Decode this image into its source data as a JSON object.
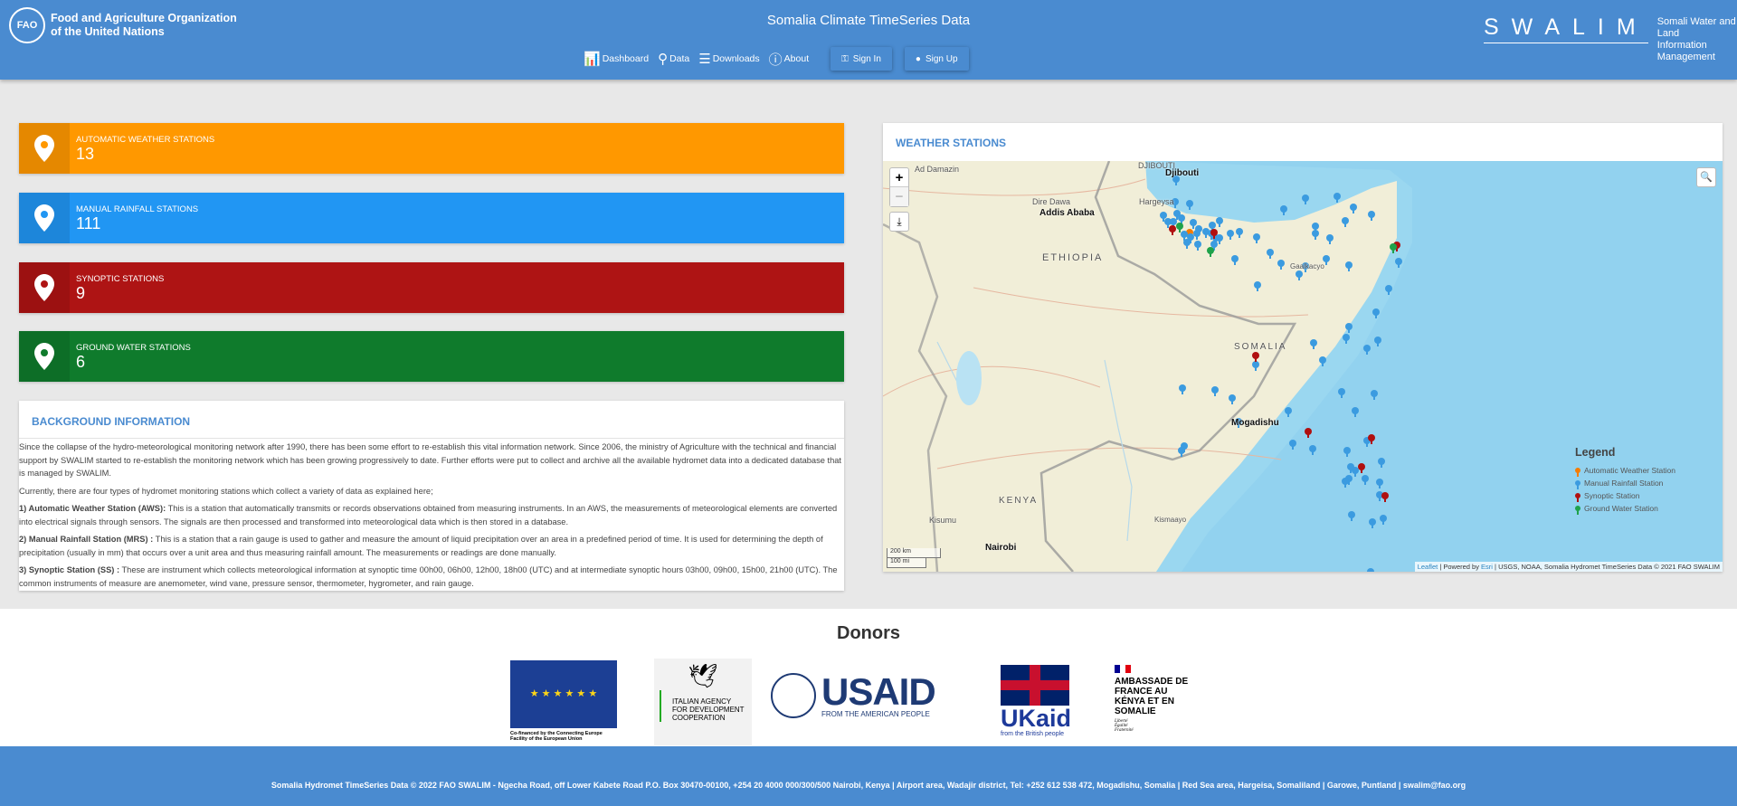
{
  "header": {
    "org_name_line1": "Food and Agriculture Organization",
    "org_name_line2": "of the United Nations",
    "title": "Somalia Climate TimeSeries Data",
    "nav": [
      {
        "label": "Dashboard",
        "icon": "bar-chart-icon"
      },
      {
        "label": "Data",
        "icon": "map-marker-icon"
      },
      {
        "label": "Downloads",
        "icon": "database-icon"
      },
      {
        "label": "About",
        "icon": "info-icon"
      }
    ],
    "sign_in": "Sign In",
    "sign_up": "Sign Up",
    "swalim_logo": "SWALIM",
    "swalim_line1": "Somali Water and Land",
    "swalim_line2": "Information Management"
  },
  "stations": [
    {
      "label": "AUTOMATIC WEATHER STATIONS",
      "count": "13",
      "color": "#ff9800"
    },
    {
      "label": "MANUAL RAINFALL STATIONS",
      "count": "111",
      "color": "#2196f3"
    },
    {
      "label": "SYNOPTIC STATIONS",
      "count": "9",
      "color": "#ae1414"
    },
    {
      "label": "GROUND WATER STATIONS",
      "count": "6",
      "color": "#0f7b2c"
    }
  ],
  "background": {
    "title": "BACKGROUND INFORMATION",
    "p1": "Since the collapse of the hydro-meteorological monitoring network after 1990, there has been some effort to re-establish this vital information network. Since 2006, the ministry of Agriculture with the technical and financial support by SWALIM started to re-establish the monitoring network which has been growing progressively to date. Further efforts were put to collect and archive all the available hydromet data into a dedicated database that is managed by SWALIM.",
    "p2": "Currently, there are four types of hydromet monitoring stations which collect a variety of data as explained here;",
    "aws_head": "1) Automatic Weather Station (AWS):",
    "aws_text": " This is a station that automatically transmits or records observations obtained from measuring instruments. In an AWS, the measurements of meteorological elements are converted into electrical signals through sensors. The signals are then processed and transformed into meteorological data which is then stored in a database.",
    "mrs_head": "2) Manual Rainfall Station (MRS) :",
    "mrs_text": " This is a station that a rain gauge is used to gather and measure the amount of liquid precipitation over an area in a predefined period of time. It is used for determining the depth of precipitation (usually in mm) that occurs over a unit area and thus measuring rainfall amount. The measurements or readings are done manually.",
    "ss_head": "3) Synoptic Station (SS) :",
    "ss_text": " These are instrument which collects meteorological information at synoptic time 00h00, 06h00, 12h00, 18h00 (UTC) and at intermediate synoptic hours 03h00, 09h00, 15h00, 21h00 (UTC). The common instruments of measure are anemometer, wind vane, pressure sensor, thermometer, hygrometer, and rain gauge."
  },
  "map": {
    "title": "WEATHER STATIONS",
    "zoom_in": "+",
    "zoom_out": "−",
    "places": {
      "ad_damazin": "Ad Damazin",
      "djibouti_country": "DJIBOUTI",
      "djibouti": "Djibouti",
      "dire_dawa": "Dire Dawa",
      "hargeysa": "Hargeysa",
      "addis": "Addis Ababa",
      "ethiopia": "ETHIOPIA",
      "gaalkacyo": "Gaalkacyo",
      "somalia": "SOMALIA",
      "mogadishu": "Mogadishu",
      "kenya": "KENYA",
      "kisumu": "Kisumu",
      "nairobi": "Nairobi",
      "kismaayo": "Kismaayo"
    },
    "legend": {
      "title": "Legend",
      "items": [
        {
          "label": "Automatic Weather Station",
          "color": "#f57c00"
        },
        {
          "label": "Manual Rainfall Station",
          "color": "#3b9be0"
        },
        {
          "label": "Synoptic Station",
          "color": "#b01010"
        },
        {
          "label": "Ground Water Station",
          "color": "#1fa24a"
        }
      ]
    },
    "scale_km": "200 km",
    "scale_mi": "100 mi",
    "attrib_leaflet": "Leaflet",
    "attrib_sep1": " | Powered by ",
    "attrib_esri": "Esri",
    "attrib_rest": " | USGS, NOAA, Somalia Hydromet TimeSeries Data © 2021 FAO SWALIM"
  },
  "donors": {
    "title": "Donors",
    "eu_caption": "Co-financed by the Connecting Europe Facility of the European Union",
    "italian": "ITALIAN AGENCY FOR DEVELOPMENT COOPERATION",
    "usaid": "USAID",
    "usaid_sub": "FROM THE AMERICAN PEOPLE",
    "ukaid": "UKaid",
    "ukaid_sub": "from the British people",
    "france": "AMBASSADE DE FRANCE AU KÉNYA ET EN SOMALIE",
    "france_motto": "Liberté Égalité Fraternité"
  },
  "footer": {
    "text": "Somalia Hydromet TimeSeries Data © 2022 FAO SWALIM - Ngecha Road, off Lower Kabete Road P.O. Box 30470-00100, +254 20 4000 000/300/500 Nairobi, Kenya | Airport area, Wadajir district, Tel: +252 612 538 472, Mogadishu, Somalia | Red Sea area, Hargeisa, Somaliland | Garowe, Puntland | swalim@fao.org"
  }
}
